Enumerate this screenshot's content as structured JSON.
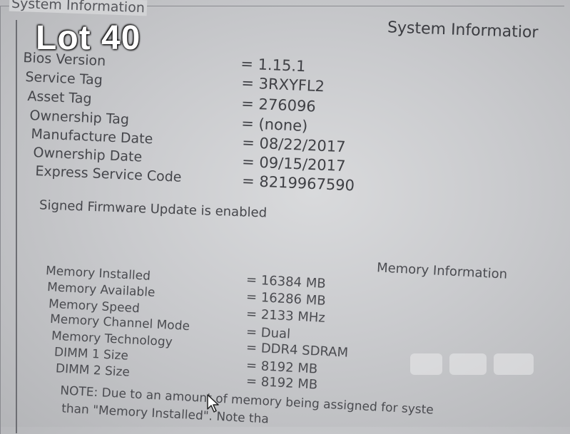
{
  "overlay_label": "Lot 40",
  "group_box_legend": "System Information",
  "section_title": "System Informatior",
  "system_info": [
    {
      "label": "Bios Version",
      "value": "= 1.15.1"
    },
    {
      "label": "Service Tag",
      "value": "= 3RXYFL2"
    },
    {
      "label": "Asset Tag",
      "value": "= 276096"
    },
    {
      "label": "Ownership Tag",
      "value": "= (none)"
    },
    {
      "label": "Manufacture Date",
      "value": "= 08/22/2017"
    },
    {
      "label": "Ownership Date",
      "value": "= 09/15/2017"
    },
    {
      "label": "Express Service Code",
      "value": "= 8219967590"
    }
  ],
  "firmware_status": "Signed Firmware Update is enabled",
  "memory_title": "Memory Information",
  "memory_info": [
    {
      "label": "Memory Installed",
      "value": "= 16384 MB"
    },
    {
      "label": "Memory Available",
      "value": "= 16286 MB"
    },
    {
      "label": "Memory Speed",
      "value": "= 2133 MHz"
    },
    {
      "label": "Memory Channel Mode",
      "value": "= Dual"
    },
    {
      "label": "Memory Technology",
      "value": "= DDR4 SDRAM"
    },
    {
      "label": "DIMM 1 Size",
      "value": "= 8192 MB"
    },
    {
      "label": "DIMM 2 Size",
      "value": "= 8192 MB"
    }
  ],
  "note_line1": "NOTE: Due to an amount of memory being assigned for syste",
  "note_line2": "than \"Memory Installed\". Note tha",
  "colors": {
    "screen_bg": "#d2d3d5",
    "text": "#45464b",
    "overlay_text": "#ffffff"
  },
  "icons": {
    "cursor": "mouse-pointer-icon",
    "watermark": "watermark-logo"
  }
}
